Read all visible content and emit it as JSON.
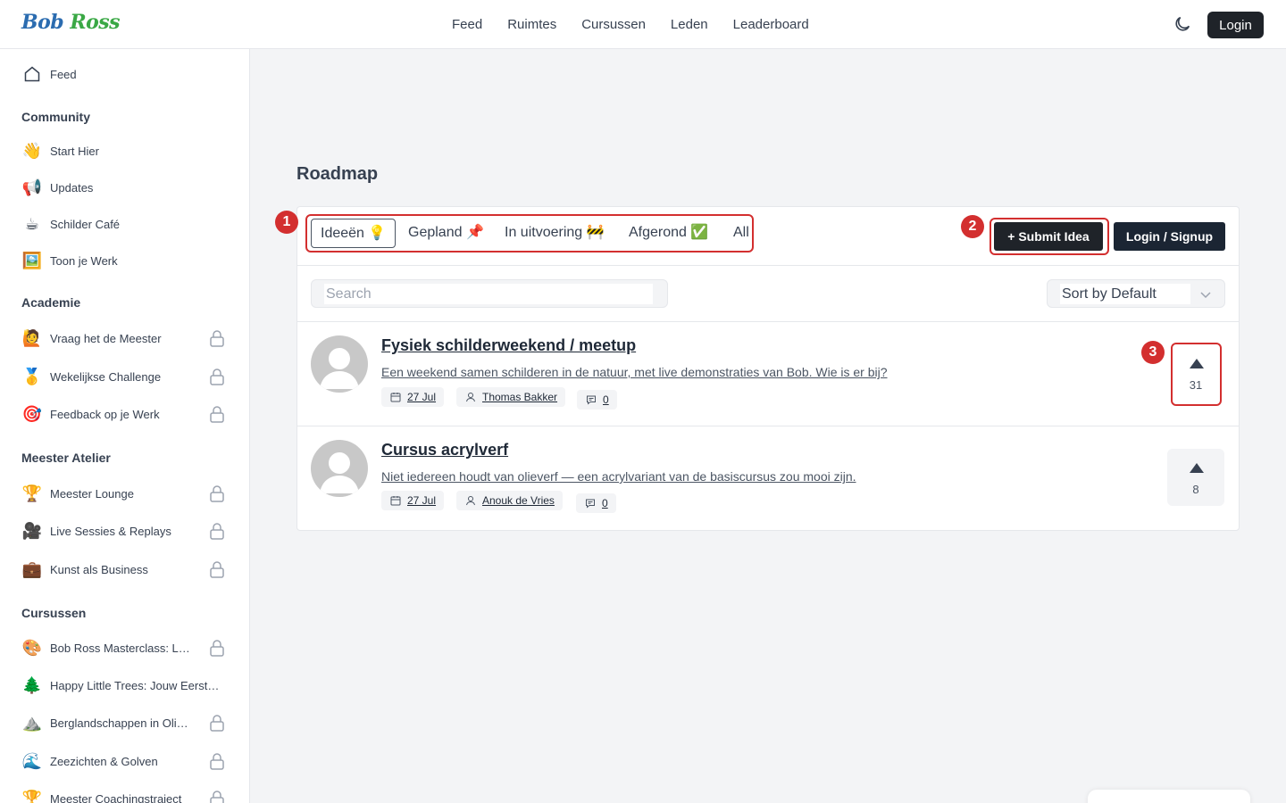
{
  "brand": {
    "part1": "Bob",
    "part2": "Ross"
  },
  "topnav": [
    "Feed",
    "Ruimtes",
    "Cursussen",
    "Leden",
    "Leaderboard"
  ],
  "header": {
    "login_label": "Login"
  },
  "sidebar": {
    "feed": {
      "label": "Feed",
      "icon": "home-icon"
    },
    "sections": [
      {
        "title": "Community",
        "items": [
          {
            "label": "Start Hier",
            "icon": "👋",
            "locked": false
          },
          {
            "label": "Updates",
            "icon": "📢",
            "locked": false
          },
          {
            "label": "Schilder Café",
            "icon": "☕",
            "locked": false
          },
          {
            "label": "Toon je Werk",
            "icon": "🖼️",
            "locked": false
          }
        ]
      },
      {
        "title": "Academie",
        "items": [
          {
            "label": "Vraag het de Meester",
            "icon": "🙋",
            "locked": true
          },
          {
            "label": "Wekelijkse Challenge",
            "icon": "🥇",
            "locked": true
          },
          {
            "label": "Feedback op je Werk",
            "icon": "🎯",
            "locked": true
          }
        ]
      },
      {
        "title": "Meester Atelier",
        "items": [
          {
            "label": "Meester Lounge",
            "icon": "🏆",
            "locked": true
          },
          {
            "label": "Live Sessies & Replays",
            "icon": "🎥",
            "locked": true
          },
          {
            "label": "Kunst als Business",
            "icon": "💼",
            "locked": true
          }
        ]
      },
      {
        "title": "Cursussen",
        "items": [
          {
            "label": "Bob Ross Masterclass: Landschappen",
            "icon": "🎨",
            "locked": true
          },
          {
            "label": "Happy Little Trees: Jouw Eerste Schilderij",
            "icon": "🌲",
            "locked": false
          },
          {
            "label": "Berglandschappen in Olieverf",
            "icon": "⛰️",
            "locked": true
          },
          {
            "label": "Zeezichten & Golven",
            "icon": "🌊",
            "locked": true
          },
          {
            "label": "Meester Coachingstraject",
            "icon": "🏆",
            "locked": true
          }
        ]
      }
    ]
  },
  "main": {
    "title": "Roadmap",
    "tabs": [
      {
        "label": "Ideeën 💡",
        "active": true
      },
      {
        "label": "Gepland 📌",
        "active": false
      },
      {
        "label": "In uitvoering 🚧",
        "active": false
      },
      {
        "label": "Afgerond ✅",
        "active": false
      },
      {
        "label": "All",
        "active": false
      }
    ],
    "submit_label": "+ Submit Idea",
    "signup_label": "Login / Signup",
    "search_placeholder": "Search",
    "sort_label": "Sort by Default",
    "annotations": [
      "1",
      "2",
      "3"
    ],
    "ideas": [
      {
        "title": "Fysiek schilderweekend / meetup",
        "description": "Een weekend samen schilderen in de natuur, met live demonstraties van Bob. Wie is er bij?",
        "date": "27 Jul",
        "author": "Thomas Bakker",
        "comments": "0",
        "votes": "31"
      },
      {
        "title": "Cursus acrylverf",
        "description": "Niet iedereen houdt van olieverf — een acrylvariant van de basiscursus zou mooi zijn.",
        "date": "27 Jul",
        "author": "Anouk de Vries",
        "comments": "0",
        "votes": "8"
      }
    ]
  },
  "colors": {
    "accent_dark": "#1f2329",
    "annotation_red": "#d32f2f",
    "brand_blue": "#2b6cb0",
    "brand_green": "#3aa845"
  }
}
